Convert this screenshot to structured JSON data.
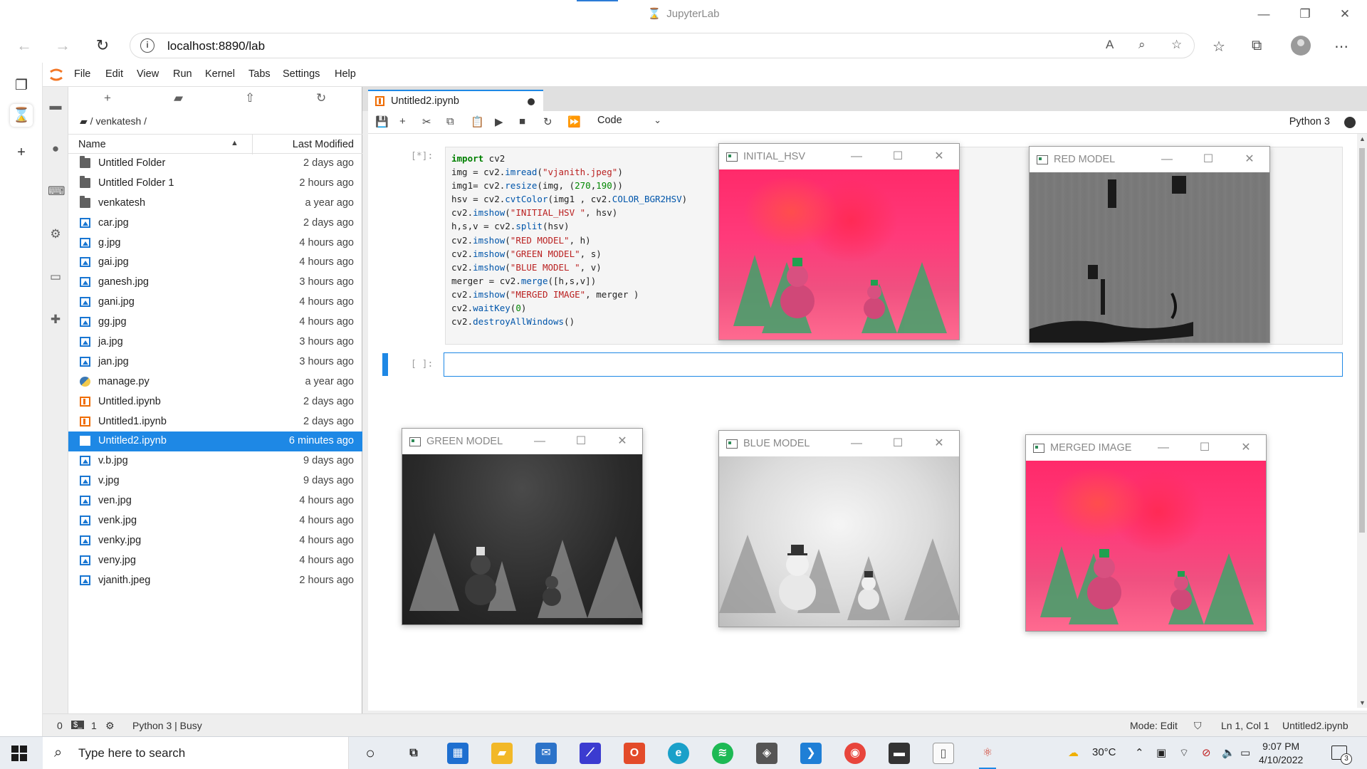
{
  "browser": {
    "window_title": "JupyterLab",
    "url": "localhost:8890/lab",
    "minimize": "—",
    "maximize": "❐",
    "close": "✕"
  },
  "jupyter": {
    "menu": [
      "File",
      "Edit",
      "View",
      "Run",
      "Kernel",
      "Tabs",
      "Settings",
      "Help"
    ],
    "breadcrumb": "/ venkatesh /",
    "columns": {
      "name": "Name",
      "modified": "Last Modified"
    },
    "files": [
      {
        "name": "Untitled Folder",
        "modified": "2 days ago",
        "type": "folder"
      },
      {
        "name": "Untitled Folder 1",
        "modified": "2 hours ago",
        "type": "folder"
      },
      {
        "name": "venkatesh",
        "modified": "a year ago",
        "type": "folder"
      },
      {
        "name": "car.jpg",
        "modified": "2 days ago",
        "type": "image"
      },
      {
        "name": "g.jpg",
        "modified": "4 hours ago",
        "type": "image"
      },
      {
        "name": "gai.jpg",
        "modified": "4 hours ago",
        "type": "image"
      },
      {
        "name": "ganesh.jpg",
        "modified": "3 hours ago",
        "type": "image"
      },
      {
        "name": "gani.jpg",
        "modified": "4 hours ago",
        "type": "image"
      },
      {
        "name": "gg.jpg",
        "modified": "4 hours ago",
        "type": "image"
      },
      {
        "name": "ja.jpg",
        "modified": "3 hours ago",
        "type": "image"
      },
      {
        "name": "jan.jpg",
        "modified": "3 hours ago",
        "type": "image"
      },
      {
        "name": "manage.py",
        "modified": "a year ago",
        "type": "python"
      },
      {
        "name": "Untitled.ipynb",
        "modified": "2 days ago",
        "type": "notebook"
      },
      {
        "name": "Untitled1.ipynb",
        "modified": "2 days ago",
        "type": "notebook"
      },
      {
        "name": "Untitled2.ipynb",
        "modified": "6 minutes ago",
        "type": "notebook",
        "selected": true
      },
      {
        "name": "v.b.jpg",
        "modified": "9 days ago",
        "type": "image"
      },
      {
        "name": "v.jpg",
        "modified": "9 days ago",
        "type": "image"
      },
      {
        "name": "ven.jpg",
        "modified": "4 hours ago",
        "type": "image"
      },
      {
        "name": "venk.jpg",
        "modified": "4 hours ago",
        "type": "image"
      },
      {
        "name": "venky.jpg",
        "modified": "4 hours ago",
        "type": "image"
      },
      {
        "name": "veny.jpg",
        "modified": "4 hours ago",
        "type": "image"
      },
      {
        "name": "vjanith.jpeg",
        "modified": "2 hours ago",
        "type": "image"
      }
    ],
    "notebook": {
      "tab_name": "Untitled2.ipynb",
      "cell_type": "Code",
      "kernel": "Python 3",
      "cell1_prompt": "[*]:",
      "cell2_prompt": "[ ]:"
    },
    "status": {
      "count0": "0",
      "count1": "1",
      "kernel_status": "Python 3 | Busy",
      "mode": "Mode: Edit",
      "position": "Ln 1, Col 1",
      "file": "Untitled2.ipynb"
    }
  },
  "code_lines": [
    [
      {
        "t": "import",
        "c": "kw"
      },
      {
        "t": " cv2"
      }
    ],
    [
      {
        "t": "img = cv2."
      },
      {
        "t": "imread",
        "c": "at"
      },
      {
        "t": "("
      },
      {
        "t": "\"vjanith.jpeg\"",
        "c": "st"
      },
      {
        "t": ")"
      }
    ],
    [
      {
        "t": "img1= cv2."
      },
      {
        "t": "resize",
        "c": "at"
      },
      {
        "t": "(img, ("
      },
      {
        "t": "270",
        "c": "nu"
      },
      {
        "t": ","
      },
      {
        "t": "190",
        "c": "nu"
      },
      {
        "t": "))"
      }
    ],
    [
      {
        "t": "hsv = cv2."
      },
      {
        "t": "cvtColor",
        "c": "at"
      },
      {
        "t": "(img1 , cv2."
      },
      {
        "t": "COLOR_BGR2HSV",
        "c": "at"
      },
      {
        "t": ")"
      }
    ],
    [
      {
        "t": "cv2."
      },
      {
        "t": "imshow",
        "c": "at"
      },
      {
        "t": "("
      },
      {
        "t": "\"INITIAL_HSV \"",
        "c": "st"
      },
      {
        "t": ", hsv)"
      }
    ],
    [
      {
        "t": "h,s,v = cv2."
      },
      {
        "t": "split",
        "c": "at"
      },
      {
        "t": "(hsv)"
      }
    ],
    [
      {
        "t": "cv2."
      },
      {
        "t": "imshow",
        "c": "at"
      },
      {
        "t": "("
      },
      {
        "t": "\"RED MODEL\"",
        "c": "st"
      },
      {
        "t": ", h)"
      }
    ],
    [
      {
        "t": "cv2."
      },
      {
        "t": "imshow",
        "c": "at"
      },
      {
        "t": "("
      },
      {
        "t": "\"GREEN MODEL\"",
        "c": "st"
      },
      {
        "t": ", s)"
      }
    ],
    [
      {
        "t": "cv2."
      },
      {
        "t": "imshow",
        "c": "at"
      },
      {
        "t": "("
      },
      {
        "t": "\"BLUE MODEL \"",
        "c": "st"
      },
      {
        "t": ", v)"
      }
    ],
    [
      {
        "t": "merger = cv2."
      },
      {
        "t": "merge",
        "c": "at"
      },
      {
        "t": "([h,s,v])"
      }
    ],
    [
      {
        "t": "cv2."
      },
      {
        "t": "imshow",
        "c": "at"
      },
      {
        "t": "("
      },
      {
        "t": "\"MERGED IMAGE\"",
        "c": "st"
      },
      {
        "t": ", merger )"
      }
    ],
    [
      {
        "t": "cv2."
      },
      {
        "t": "waitKey",
        "c": "at"
      },
      {
        "t": "("
      },
      {
        "t": "0",
        "c": "nu"
      },
      {
        "t": ")"
      }
    ],
    [
      {
        "t": "cv2."
      },
      {
        "t": "destroyAllWindows",
        "c": "at"
      },
      {
        "t": "()"
      }
    ]
  ],
  "cv_windows": {
    "initial": "INITIAL_HSV",
    "red": "RED MODEL",
    "green": "GREEN MODEL",
    "blue": "BLUE MODEL",
    "merged": "MERGED IMAGE"
  },
  "taskbar": {
    "search_placeholder": "Type here to search",
    "temperature": "30°C",
    "time": "9:07 PM",
    "date": "4/10/2022",
    "notifications": "3"
  }
}
